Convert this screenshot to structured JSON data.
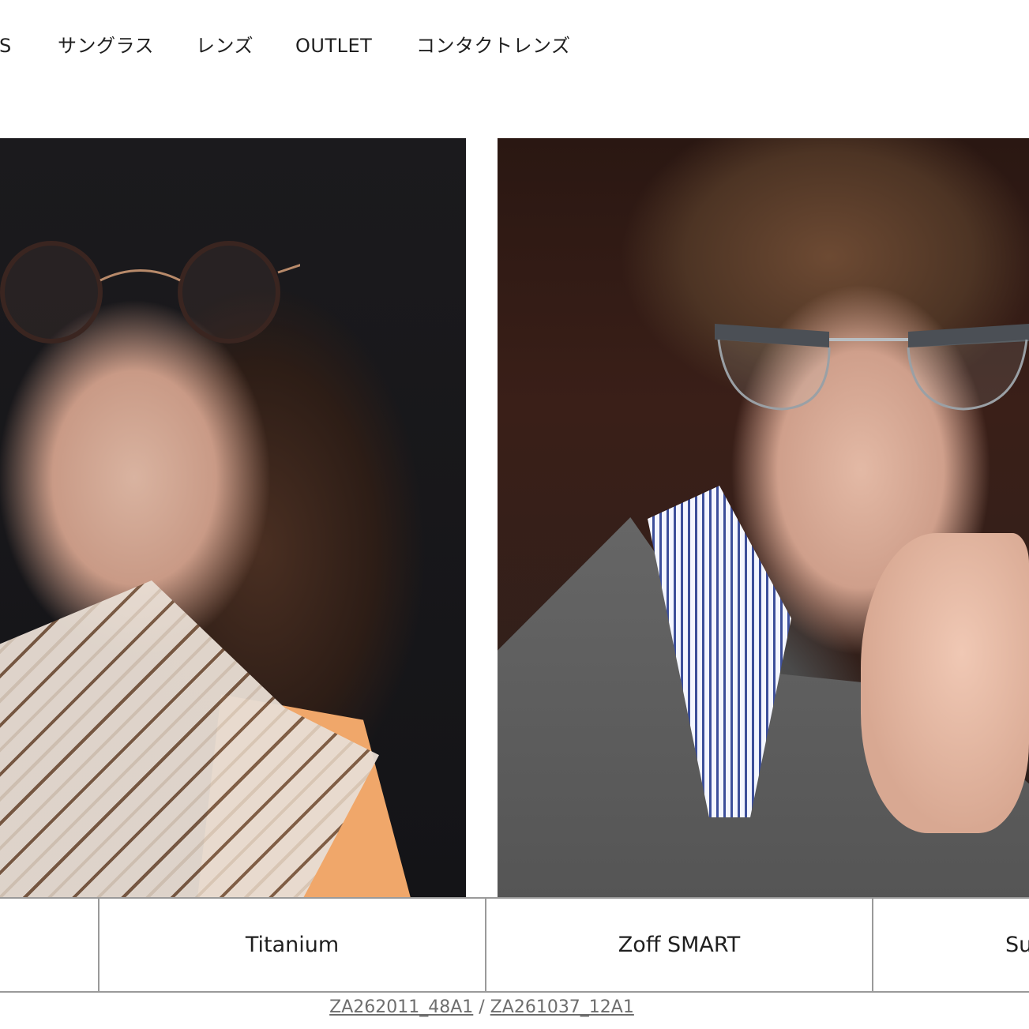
{
  "nav": {
    "items": [
      {
        "label": "DS"
      },
      {
        "label": "サングラス"
      },
      {
        "label": "レンズ"
      },
      {
        "label": "OUTLET"
      },
      {
        "label": "コンタクトレンズ"
      }
    ]
  },
  "photos": {
    "left": {
      "subject": "woman-with-round-glasses"
    },
    "right": {
      "subject": "man-with-browline-glasses"
    }
  },
  "tabs": [
    {
      "label": ""
    },
    {
      "label": "Titanium"
    },
    {
      "label": "Zoff SMART"
    },
    {
      "label": "Su"
    }
  ],
  "caption": {
    "link1": "ZA262011_48A1",
    "separator": " / ",
    "link2": "ZA261037_12A1"
  }
}
